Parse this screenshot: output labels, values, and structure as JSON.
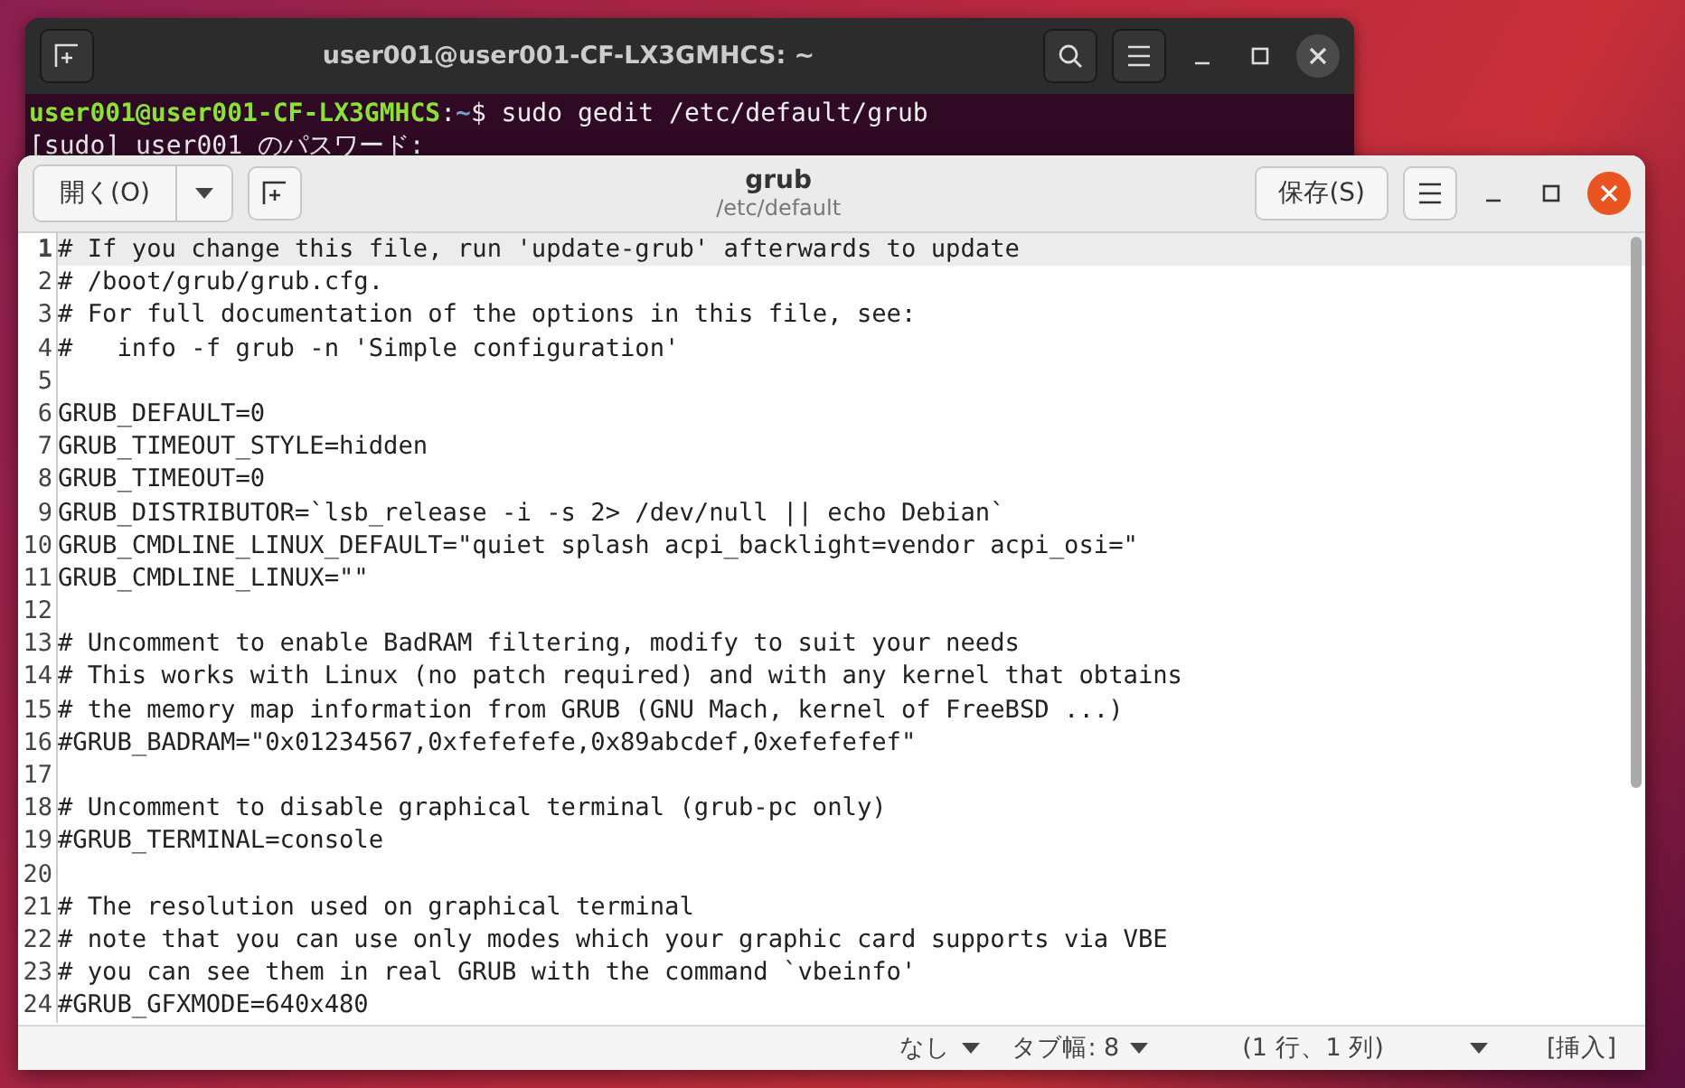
{
  "terminal": {
    "title": "user001@user001-CF-LX3GMHCS: ~",
    "lines": [
      {
        "user": "user001@user001-CF-LX3GMHCS",
        "sep": ":",
        "path": "~",
        "command": "$ sudo gedit /etc/default/grub"
      },
      {
        "command": "[sudo] user001 のパスワード:"
      }
    ]
  },
  "editor": {
    "open_button": "開く(O)",
    "title": "grub",
    "subtitle": "/etc/default",
    "save_button": "保存(S)",
    "lines": [
      {
        "number": "1",
        "text": "# If you change this file, run 'update-grub' afterwards to update",
        "current": true
      },
      {
        "number": "2",
        "text": "# /boot/grub/grub.cfg.",
        "current": false
      },
      {
        "number": "3",
        "text": "# For full documentation of the options in this file, see:",
        "current": false
      },
      {
        "number": "4",
        "text": "#   info -f grub -n 'Simple configuration'",
        "current": false
      },
      {
        "number": "5",
        "current": false
      },
      {
        "number": "6",
        "text": "GRUB_DEFAULT=0",
        "current": false
      },
      {
        "number": "7",
        "text": "GRUB_TIMEOUT_STYLE=hidden",
        "current": false
      },
      {
        "number": "8",
        "text": "GRUB_TIMEOUT=0",
        "current": false
      },
      {
        "number": "9",
        "text": "GRUB_DISTRIBUTOR=`lsb_release -i -s 2> /dev/null || echo Debian`",
        "current": false
      },
      {
        "number": "10",
        "text": "GRUB_CMDLINE_LINUX_DEFAULT=\"quiet splash acpi_backlight=vendor acpi_osi=\"",
        "current": false
      },
      {
        "number": "11",
        "text": "GRUB_CMDLINE_LINUX=\"\"",
        "current": false
      },
      {
        "number": "12",
        "current": false
      },
      {
        "number": "13",
        "text": "# Uncomment to enable BadRAM filtering, modify to suit your needs",
        "current": false
      },
      {
        "number": "14",
        "text": "# This works with Linux (no patch required) and with any kernel that obtains",
        "current": false
      },
      {
        "number": "15",
        "text": "# the memory map information from GRUB (GNU Mach, kernel of FreeBSD ...)",
        "current": false
      },
      {
        "number": "16",
        "text": "#GRUB_BADRAM=\"0x01234567,0xfefefefe,0x89abcdef,0xefefefef\"",
        "current": false
      },
      {
        "number": "17",
        "current": false
      },
      {
        "number": "18",
        "text": "# Uncomment to disable graphical terminal (grub-pc only)",
        "current": false
      },
      {
        "number": "19",
        "text": "#GRUB_TERMINAL=console",
        "current": false
      },
      {
        "number": "20",
        "current": false
      },
      {
        "number": "21",
        "text": "# The resolution used on graphical terminal",
        "current": false
      },
      {
        "number": "22",
        "text": "# note that you can use only modes which your graphic card supports via VBE",
        "current": false
      },
      {
        "number": "23",
        "text": "# you can see them in real GRUB with the command `vbeinfo'",
        "current": false
      },
      {
        "number": "24",
        "text": "#GRUB_GFXMODE=640x480",
        "current": false
      }
    ],
    "status": {
      "language": "なし",
      "tab_width": "タブ幅: 8",
      "position": "(1 行、1 列)",
      "mode": "[挿入]"
    }
  }
}
